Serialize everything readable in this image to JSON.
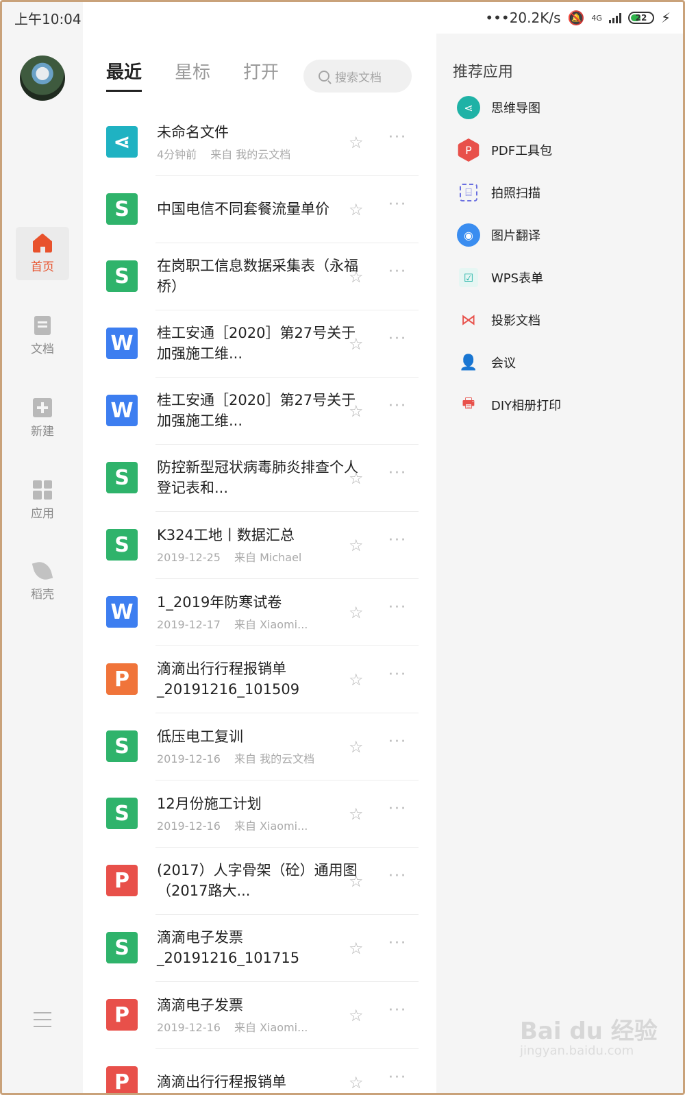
{
  "status": {
    "time": "上午10:04",
    "speed": "•••20.2K/s",
    "network": "4G",
    "battery": "22"
  },
  "nav": {
    "items": [
      {
        "label": "首页"
      },
      {
        "label": "文档"
      },
      {
        "label": "新建"
      },
      {
        "label": "应用"
      },
      {
        "label": "稻壳"
      }
    ]
  },
  "main": {
    "tabs": [
      {
        "label": "最近"
      },
      {
        "label": "星标"
      },
      {
        "label": "打开"
      }
    ],
    "search_placeholder": "搜索文档"
  },
  "files": [
    {
      "type": "mind",
      "glyph": "⋖",
      "title": "未命名文件",
      "time": "4分钟前",
      "source": "来自 我的云文档"
    },
    {
      "type": "sheet",
      "glyph": "S",
      "title": "中国电信不同套餐流量单价",
      "time": "",
      "source": ""
    },
    {
      "type": "sheet",
      "glyph": "S",
      "title": "在岗职工信息数据采集表（永福桥）",
      "time": "",
      "source": ""
    },
    {
      "type": "word",
      "glyph": "W",
      "title": "桂工安通［2020］第27号关于加强施工维...",
      "time": "",
      "source": ""
    },
    {
      "type": "word",
      "glyph": "W",
      "title": "桂工安通［2020］第27号关于加强施工维...",
      "time": "",
      "source": ""
    },
    {
      "type": "sheet",
      "glyph": "S",
      "title": "防控新型冠状病毒肺炎排查个人登记表和...",
      "time": "",
      "source": ""
    },
    {
      "type": "sheet",
      "glyph": "S",
      "title": "K324工地丨数据汇总",
      "time": "2019-12-25",
      "source": "来自 Michael"
    },
    {
      "type": "word",
      "glyph": "W",
      "title": "1_2019年防寒试卷",
      "time": "2019-12-17",
      "source": "来自 Xiaomi..."
    },
    {
      "type": "ppt",
      "glyph": "P",
      "title": "滴滴出行行程报销单_20191216_101509",
      "time": "",
      "source": ""
    },
    {
      "type": "sheet",
      "glyph": "S",
      "title": "低压电工复训",
      "time": "2019-12-16",
      "source": "来自 我的云文档"
    },
    {
      "type": "sheet",
      "glyph": "S",
      "title": "12月份施工计划",
      "time": "2019-12-16",
      "source": "来自 Xiaomi..."
    },
    {
      "type": "pdf",
      "glyph": "P",
      "title": "(2017）人字骨架（砼）通用图（2017路大...",
      "time": "",
      "source": ""
    },
    {
      "type": "sheet",
      "glyph": "S",
      "title": "滴滴电子发票_20191216_101715",
      "time": "",
      "source": ""
    },
    {
      "type": "pdf",
      "glyph": "P",
      "title": "滴滴电子发票",
      "time": "2019-12-16",
      "source": "来自 Xiaomi..."
    },
    {
      "type": "pdf",
      "glyph": "P",
      "title": "滴滴出行行程报销单",
      "time": "",
      "source": ""
    }
  ],
  "recommend": {
    "title": "推荐应用",
    "items": [
      {
        "label": "思维导图",
        "icon": "mind-map-icon"
      },
      {
        "label": "PDF工具包",
        "icon": "pdf-toolkit-icon"
      },
      {
        "label": "拍照扫描",
        "icon": "scan-icon"
      },
      {
        "label": "图片翻译",
        "icon": "translate-icon"
      },
      {
        "label": "WPS表单",
        "icon": "form-icon"
      },
      {
        "label": "投影文档",
        "icon": "projection-icon"
      },
      {
        "label": "会议",
        "icon": "meeting-icon"
      },
      {
        "label": "DIY相册打印",
        "icon": "print-icon"
      }
    ]
  },
  "colors": {
    "sheet": "#2fb36b",
    "word": "#3d7ef0",
    "ppt": "#f0743a",
    "pdf": "#e8504a",
    "mind": "#1fb2c2",
    "accent": "#e8522c"
  },
  "watermark": {
    "main": "Bai du 经验",
    "sub": "jingyan.baidu.com"
  }
}
